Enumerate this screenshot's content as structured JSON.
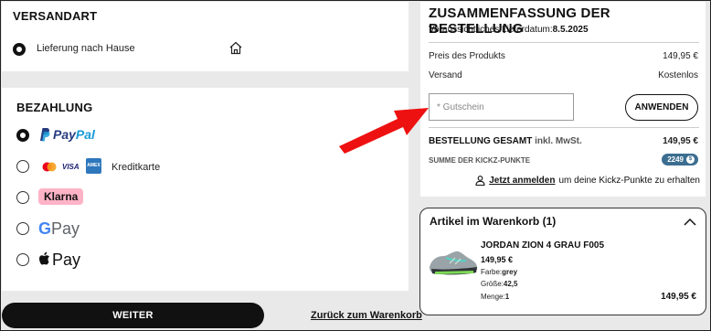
{
  "shipping": {
    "title": "VERSANDART",
    "option_label": "Lieferung nach Hause",
    "icon": "home-icon"
  },
  "payment": {
    "title": "BEZAHLUNG",
    "options": [
      {
        "brand_text_1": "Pay",
        "brand_text_2": "Pal",
        "selected": true
      },
      {
        "label": "Kreditkarte",
        "card_icons": [
          "mastercard-icon",
          "visa-icon",
          "amex-icon"
        ],
        "visa_text": "VISA",
        "amex_text": "AMEX",
        "selected": false
      },
      {
        "label": "Klarna",
        "selected": false
      },
      {
        "g": "G",
        "label": "Pay",
        "selected": false
      },
      {
        "label": "Pay",
        "selected": false
      }
    ]
  },
  "actions": {
    "continue_label": "WEITER",
    "back_label": "Zurück zum Warenkorb"
  },
  "summary": {
    "title": "ZUSAMMENFASSUNG DER BESTELLUNG",
    "delivery_label": "Voraussichtliches Lieferdatum:",
    "delivery_date": "8.5.2025",
    "product_price_label": "Preis des Produkts",
    "product_price_value": "149,95 €",
    "shipping_label": "Versand",
    "shipping_value": "Kostenlos",
    "coupon_placeholder": "* Gutschein",
    "apply_label": "ANWENDEN",
    "total_label": "BESTELLUNG GESAMT",
    "total_suffix": "inkl. MwSt.",
    "total_value": "149,95 €",
    "points_label": "SUMME DER KICKZ-PUNKTE",
    "points_value": "2249",
    "login_link": "Jetzt anmelden",
    "login_rest": "um deine Kickz-Punkte zu erhalten"
  },
  "cart": {
    "title": "Artikel im Warenkorb (1)",
    "item": {
      "name": "JORDAN ZION 4 GRAU F005",
      "price": "149,95 €",
      "color_label": "Farbe:",
      "color_value": "grey",
      "size_label": "Größe:",
      "size_value": "42,5",
      "qty_label": "Menge:",
      "qty_value": "1",
      "line_total": "149,95 €"
    }
  },
  "colors": {
    "annotation_arrow": "#ee1111",
    "points_badge": "#3c6e90",
    "klarna": "#ffb3c7"
  }
}
